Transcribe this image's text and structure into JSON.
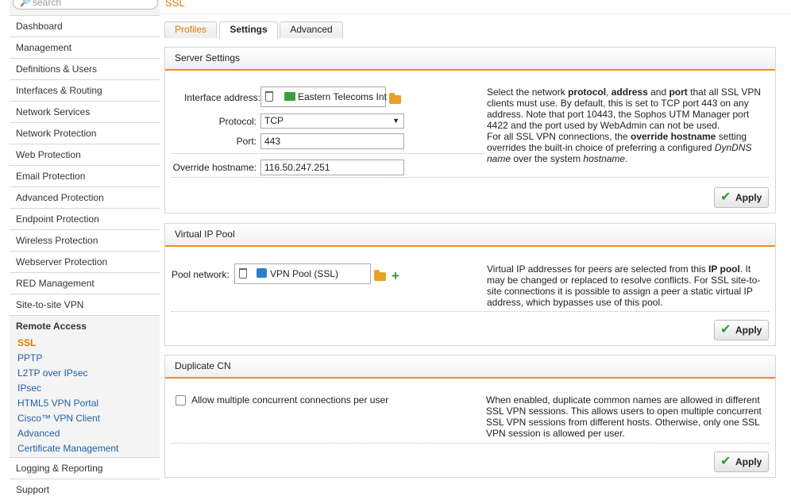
{
  "sidebar": {
    "search_placeholder": "search",
    "items": [
      {
        "label": "Dashboard"
      },
      {
        "label": "Management"
      },
      {
        "label": "Definitions & Users"
      },
      {
        "label": "Interfaces & Routing"
      },
      {
        "label": "Network Services"
      },
      {
        "label": "Network Protection"
      },
      {
        "label": "Web Protection"
      },
      {
        "label": "Email Protection"
      },
      {
        "label": "Advanced Protection"
      },
      {
        "label": "Endpoint Protection"
      },
      {
        "label": "Wireless Protection"
      },
      {
        "label": "Webserver Protection"
      },
      {
        "label": "RED Management"
      },
      {
        "label": "Site-to-site VPN"
      }
    ],
    "group": {
      "label": "Remote Access",
      "sub_items": [
        {
          "label": "SSL"
        },
        {
          "label": "PPTP"
        },
        {
          "label": "L2TP over IPsec"
        },
        {
          "label": "IPsec"
        },
        {
          "label": "HTML5 VPN Portal"
        },
        {
          "label": "Cisco™ VPN Client"
        },
        {
          "label": "Advanced"
        },
        {
          "label": "Certificate Management"
        }
      ]
    },
    "after": [
      {
        "label": "Logging & Reporting"
      },
      {
        "label": "Support"
      }
    ]
  },
  "header": {
    "title": "SSL"
  },
  "tabs": [
    {
      "label": "Profiles"
    },
    {
      "label": "Settings"
    },
    {
      "label": "Advanced"
    }
  ],
  "server_settings": {
    "title": "Server Settings",
    "interface_label": "Interface address:",
    "interface_value": "Eastern Telecoms Int",
    "protocol_label": "Protocol:",
    "protocol_value": "TCP",
    "port_label": "Port:",
    "port_value": "443",
    "override_label": "Override hostname:",
    "override_value": "116.50.247.251",
    "help_1": "Select the network ",
    "help_b1": "protocol",
    "help_2": ", ",
    "help_b2": "address",
    "help_3": " and ",
    "help_b3": "port",
    "help_4": " that all SSL VPN clients must use. By default, this is set to TCP port 443 on any address. Note that port 10443, the Sophos UTM Manager port 4422 and the port used by WebAdmin can not be used.",
    "help_5": "For all SSL VPN connections, the ",
    "help_b4": "override hostname",
    "help_6": " setting overrides the built-in choice of preferring a configured ",
    "help_i1": "DynDNS name",
    "help_7": " over the system ",
    "help_i2": "hostname",
    "help_8": ".",
    "apply_label": "Apply"
  },
  "virtual_ip_pool": {
    "title": "Virtual IP Pool",
    "pool_label": "Pool network:",
    "pool_value": "VPN Pool (SSL)",
    "help_1": "Virtual IP addresses for peers are selected from this ",
    "help_b1": "IP pool",
    "help_2": ". It may be changed or replaced to resolve conflicts. For SSL site-to-site connections it is possible to assign a peer a static virtual IP address, which bypasses use of this pool.",
    "apply_label": "Apply"
  },
  "duplicate_cn": {
    "title": "Duplicate CN",
    "checkbox_label": "Allow multiple concurrent connections per user",
    "checkbox_checked": false,
    "help": "When enabled, duplicate common names are allowed in different SSL VPN sessions. This allows users to open multiple concurrent SSL VPN sessions from different hosts. Otherwise, only one SSL VPN session is allowed per user.",
    "apply_label": "Apply"
  },
  "colors": {
    "accent": "#e8901c",
    "link": "#1f5fa6",
    "active": "#e07a00",
    "ok": "#2e9b2e"
  },
  "icons": [
    "search-icon",
    "trash-icon",
    "network-flag-icon",
    "folder-icon",
    "network-pool-icon",
    "plus-icon",
    "check-icon",
    "dropdown-arrow-icon"
  ]
}
